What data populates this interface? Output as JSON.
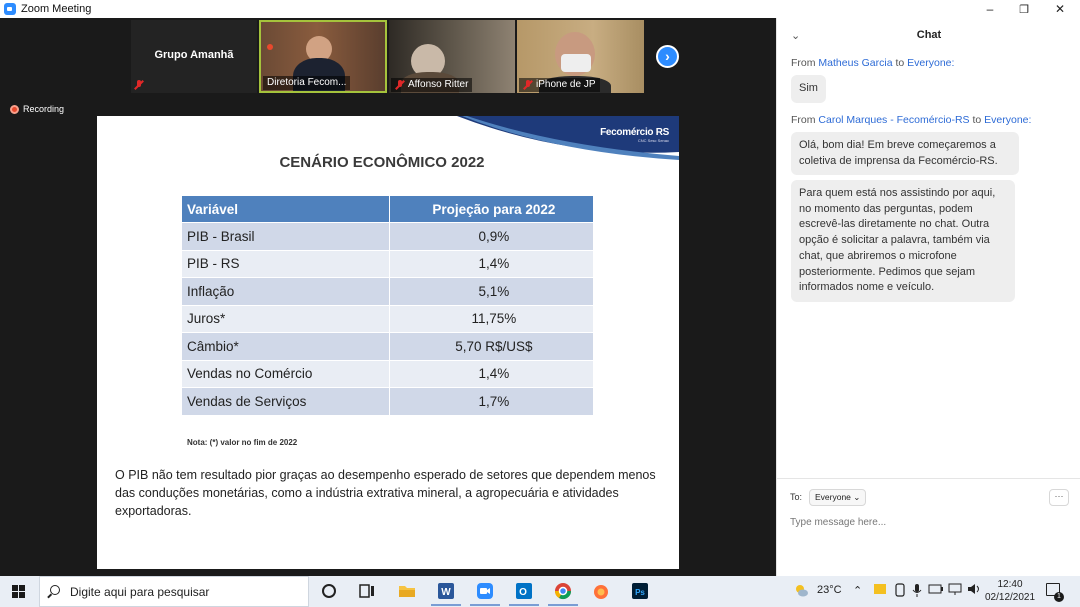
{
  "window": {
    "title": "Zoom Meeting",
    "controls": {
      "minimize": "–",
      "restore": "❐",
      "close": "✕"
    }
  },
  "participants": {
    "group_name": "Grupo Amanhã",
    "tiles": [
      {
        "name": "Diretoria Fecom...",
        "muted": true,
        "active_speaker": true
      },
      {
        "name": "Affonso Ritter",
        "muted": true,
        "active_speaker": false
      },
      {
        "name": "iPhone de JP",
        "muted": true,
        "active_speaker": false
      }
    ],
    "next_icon": "chevron-right-icon"
  },
  "recording": {
    "label": "Recording"
  },
  "slide": {
    "brand": "Fecomércio RS",
    "brand_sub": "CNC Sesc Senac",
    "title": "CENÁRIO ECONÔMICO 2022",
    "table": {
      "headers": [
        "Variável",
        "Projeção para 2022"
      ],
      "rows": [
        [
          "PIB - Brasil",
          "0,9%"
        ],
        [
          "PIB - RS",
          "1,4%"
        ],
        [
          "Inflação",
          "5,1%"
        ],
        [
          "Juros*",
          "11,75%"
        ],
        [
          "Câmbio*",
          "5,70 R$/US$"
        ],
        [
          "Vendas no Comércio",
          "1,4%"
        ],
        [
          "Vendas de Serviços",
          "1,7%"
        ]
      ]
    },
    "note": "Nota: (*) valor no fim de 2022",
    "paragraph": "O PIB não tem resultado pior graças ao desempenho esperado de setores que dependem menos das conduções monetárias, como a indústria extrativa mineral, a agropecuária e atividades exportadoras."
  },
  "chat": {
    "title": "Chat",
    "messages": [
      {
        "from_prefix": "From",
        "sender": "Matheus Garcia",
        "to_word": "to",
        "recipient": "Everyone:",
        "bubbles": [
          "Sim"
        ]
      },
      {
        "from_prefix": "From",
        "sender": "Carol Marques - Fecomércio-RS",
        "to_word": "to",
        "recipient": "Everyone:",
        "bubbles": [
          "Olá, bom dia! Em breve começaremos a coletiva de imprensa da Fecomércio-RS.",
          "Para quem está nos assistindo por aqui, no momento das perguntas, podem escrevê-las diretamente no chat. Outra opção é solicitar a palavra, também via chat, que abriremos o microfone posteriormente. Pedimos que sejam informados nome e veículo."
        ]
      }
    ],
    "to_label": "To:",
    "recipient_select": "Everyone",
    "more_label": "···",
    "input_placeholder": "Type message here..."
  },
  "taskbar": {
    "search_placeholder": "Digite aqui para pesquisar",
    "apps": [
      "task-view-icon",
      "file-explorer-icon",
      "word-icon",
      "zoom-icon",
      "outlook-icon",
      "chrome-icon",
      "firefox-icon",
      "photoshop-icon"
    ],
    "weather": "23°C",
    "time": "12:40",
    "date": "02/12/2021",
    "notifications": "1",
    "colors": {
      "accent": "#2d8cff",
      "table_header": "#4f81bd",
      "muted": "#e02828"
    }
  }
}
